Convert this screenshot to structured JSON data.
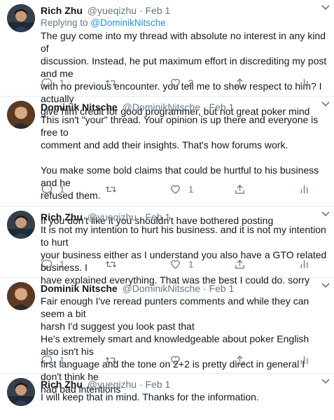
{
  "tweets": [
    {
      "name": "Rich Zhu",
      "handle": "@yueqizhu",
      "date": "Feb 1",
      "replying_prefix": "Replying to ",
      "replying_to": "@DominikNitsche",
      "lines": [
        "The guy come into my thread with absolute no interest in any kind of",
        "discussion. Instead, he put maximum effort in discrediting my post and me",
        "with no previous encounter. you tell me to show respect to him? I actually",
        "give him credit for good programmer, but not great poker mind"
      ],
      "reply_count": "1",
      "retweet_count": "",
      "like_count": "2"
    },
    {
      "name": "Dominik Nitsche",
      "handle": "@DominikNitsche",
      "date": "Feb 1",
      "lines": [
        "This isn't \"your\" thread. Your opinion is up there and everyone is free to",
        "comment and add their insights. That's how forums work.",
        "You make some bold claims that could be hurtful to his business and  he",
        "refused them.",
        "If you don't like it you shouldn't have bothered posting"
      ],
      "reply_count": "1",
      "retweet_count": "",
      "like_count": "1"
    },
    {
      "name": "Rich Zhu",
      "handle": "@yueqizhu",
      "date": "Feb 1",
      "lines": [
        "It is not my intention to hurt his business. and it is not my intention to hurt",
        "your business either as I understand you also have a GTO related business. I",
        "have explained everything. That was the best I could do. sorry"
      ],
      "reply_count": "1",
      "retweet_count": "",
      "like_count": "1"
    },
    {
      "name": "Dominik Nitsche",
      "handle": "@DominikNitsche",
      "date": "Feb 1",
      "lines": [
        "Fair enough I've reread punters comments and while they can seem a bit",
        "harsh I'd suggest you look past that",
        "He's extremely smart and knowledgeable about poker English also isn't his",
        "first language and the tone on 2+2 is pretty direct in general I don't think he",
        "had bad intentions"
      ],
      "reply_count": "1",
      "retweet_count": "",
      "like_count": ""
    },
    {
      "name": "Rich Zhu",
      "handle": "@yueqizhu",
      "date": "Feb 1",
      "lines": [
        "I will keep that in mind. Thanks for the information."
      ]
    }
  ],
  "separator": "·",
  "icons": {
    "reply": "reply-icon",
    "retweet": "retweet-icon",
    "like": "heart-icon",
    "share": "share-icon",
    "analytics": "analytics-icon",
    "more": "chevron-down-icon"
  },
  "colors": {
    "text": "#14171a",
    "secondary": "#657786",
    "link": "#1b95e0",
    "divider": "#e6ecf0"
  }
}
